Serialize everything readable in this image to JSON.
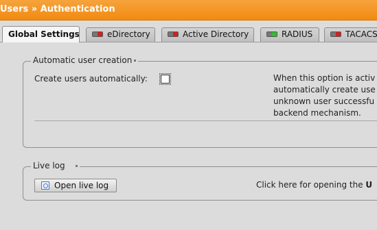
{
  "header": {
    "section": "Users",
    "separator": "»",
    "page": "Authentication"
  },
  "tabs": [
    {
      "label": "Global Settings",
      "active": true
    },
    {
      "label": "eDirectory",
      "status": "red"
    },
    {
      "label": "Active Directory",
      "status": "red"
    },
    {
      "label": "RADIUS",
      "status": "green"
    },
    {
      "label": "TACACS",
      "status": "red"
    }
  ],
  "auto_user": {
    "legend": "Automatic user creation",
    "label": "Create users automatically:",
    "checked": false,
    "description": [
      "When this option is activ",
      "automatically create use",
      "unknown user successfu",
      "backend mechanism."
    ]
  },
  "live_log": {
    "legend": "Live log",
    "button_label": "Open live log",
    "description_prefix": "Click here for opening the ",
    "description_bold": "U"
  },
  "colors": {
    "header": "#f28a10",
    "led_red": "#d32020",
    "led_green": "#2fc02f"
  }
}
